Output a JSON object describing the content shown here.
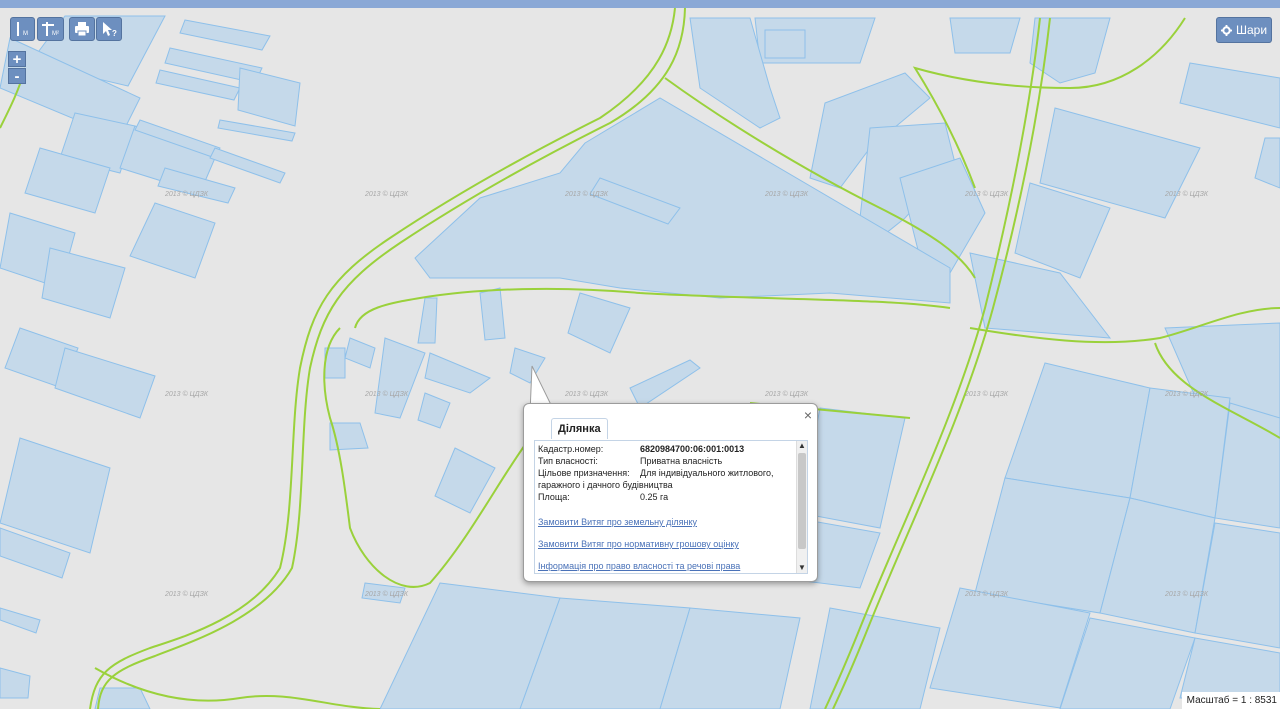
{
  "toolbar": {
    "measure_distance_label": "М",
    "measure_area_label": "М²",
    "print_icon": "printer-icon",
    "info_icon": "cursor-help-icon"
  },
  "zoom": {
    "in_label": "+",
    "out_label": "-"
  },
  "layers_button": {
    "label": "Шари",
    "icon": "gear-icon"
  },
  "watermark": "2013 © ЦДЗК",
  "popup": {
    "tab_title": "Ділянка",
    "close_label": "×",
    "fields": [
      {
        "label": "Кадастр.номер:",
        "value": "6820984700:06:001:0013"
      },
      {
        "label": "Тип власності:",
        "value": "Приватна власність"
      },
      {
        "label": "Цільове призначення:",
        "value": "Для індивідуального житлового,"
      },
      {
        "label": "",
        "value": "гаражного і дачного будівництва"
      },
      {
        "label": "Площа:",
        "value": "0.25 га"
      }
    ],
    "links": [
      "Замовити Витяг про земельну ділянку",
      "Замовити Витяг про нормативну грошову оцінку",
      "Інформація про право власності та речові права"
    ]
  },
  "scale_text": "Масштаб = 1 : 8531",
  "colors": {
    "parcel_fill": "#c5d9ea",
    "parcel_stroke": "#8ec0ea",
    "boundary": "#9ad13b",
    "map_bg": "#e6e6e6",
    "button": "#6d8fbf"
  }
}
